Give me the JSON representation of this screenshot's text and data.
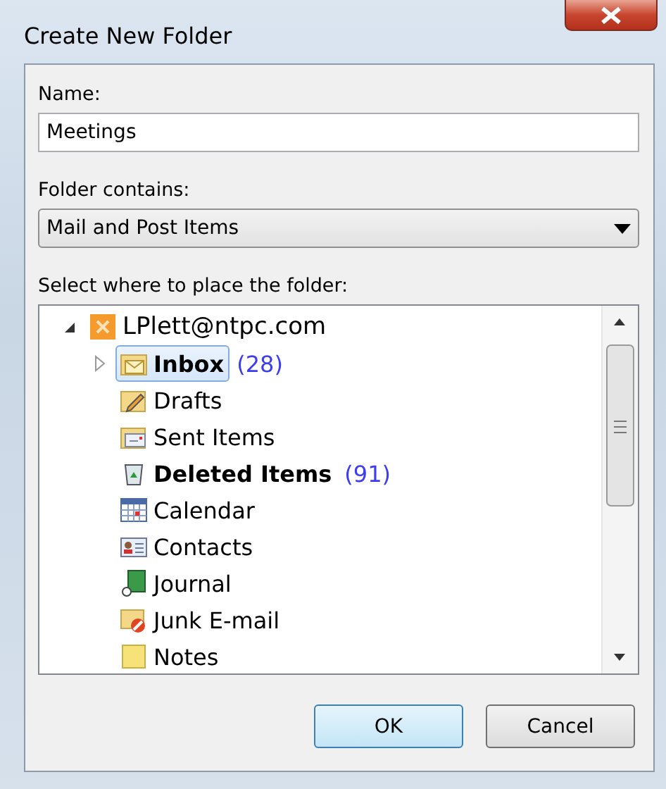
{
  "window": {
    "title": "Create New Folder"
  },
  "name_field": {
    "label": "Name:",
    "value": "Meetings"
  },
  "contains_field": {
    "label": "Folder contains:",
    "value": "Mail and Post Items"
  },
  "tree": {
    "label": "Select where to place the folder:",
    "root": {
      "name": "LPlett@ntpc.com",
      "kind": "account",
      "expanded": true,
      "selected": false,
      "bold": false,
      "children": [
        {
          "name": "Inbox",
          "count": "(28)",
          "kind": "inbox",
          "expanded": false,
          "selected": true,
          "bold": true
        },
        {
          "name": "Drafts",
          "kind": "drafts",
          "selected": false,
          "bold": false
        },
        {
          "name": "Sent Items",
          "kind": "sent",
          "selected": false,
          "bold": false
        },
        {
          "name": "Deleted Items",
          "count": "(91)",
          "kind": "deleted",
          "selected": false,
          "bold": true
        },
        {
          "name": "Calendar",
          "kind": "calendar",
          "selected": false,
          "bold": false
        },
        {
          "name": "Contacts",
          "kind": "contacts",
          "selected": false,
          "bold": false
        },
        {
          "name": "Journal",
          "kind": "journal",
          "selected": false,
          "bold": false
        },
        {
          "name": "Junk E-mail",
          "kind": "junk",
          "selected": false,
          "bold": false
        },
        {
          "name": "Notes",
          "kind": "notes",
          "selected": false,
          "bold": false
        }
      ]
    }
  },
  "buttons": [
    {
      "label": "OK",
      "default": true
    },
    {
      "label": "Cancel",
      "default": false
    }
  ]
}
